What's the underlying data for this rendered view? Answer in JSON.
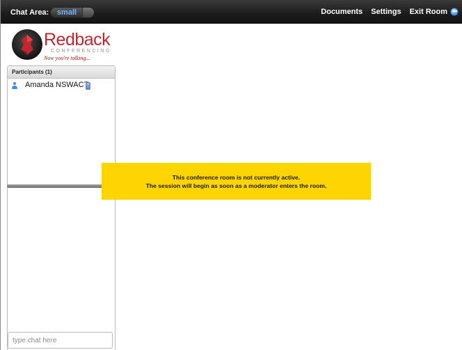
{
  "topbar": {
    "chat_area_label": "Chat Area:",
    "chat_area_value": "small",
    "nav": {
      "documents": "Documents",
      "settings": "Settings",
      "exit_room": "Exit Room"
    },
    "accent_color": "#6fb6ff"
  },
  "logo": {
    "brand": "Redback",
    "subtitle": "CONFERENCING",
    "tagline": "Now you're talking..."
  },
  "participants": {
    "header": "Participants (1)",
    "items": [
      {
        "name": "Amanda NSWACT",
        "icon": "user-icon",
        "status_icon": "phone-icon"
      }
    ]
  },
  "chat": {
    "input_placeholder": "type chat here",
    "input_value": ""
  },
  "notice": {
    "line1": "This conference room is not currently active.",
    "line2": "The session will begin as soon as a moderator enters the room.",
    "background_color": "#ffd500"
  }
}
